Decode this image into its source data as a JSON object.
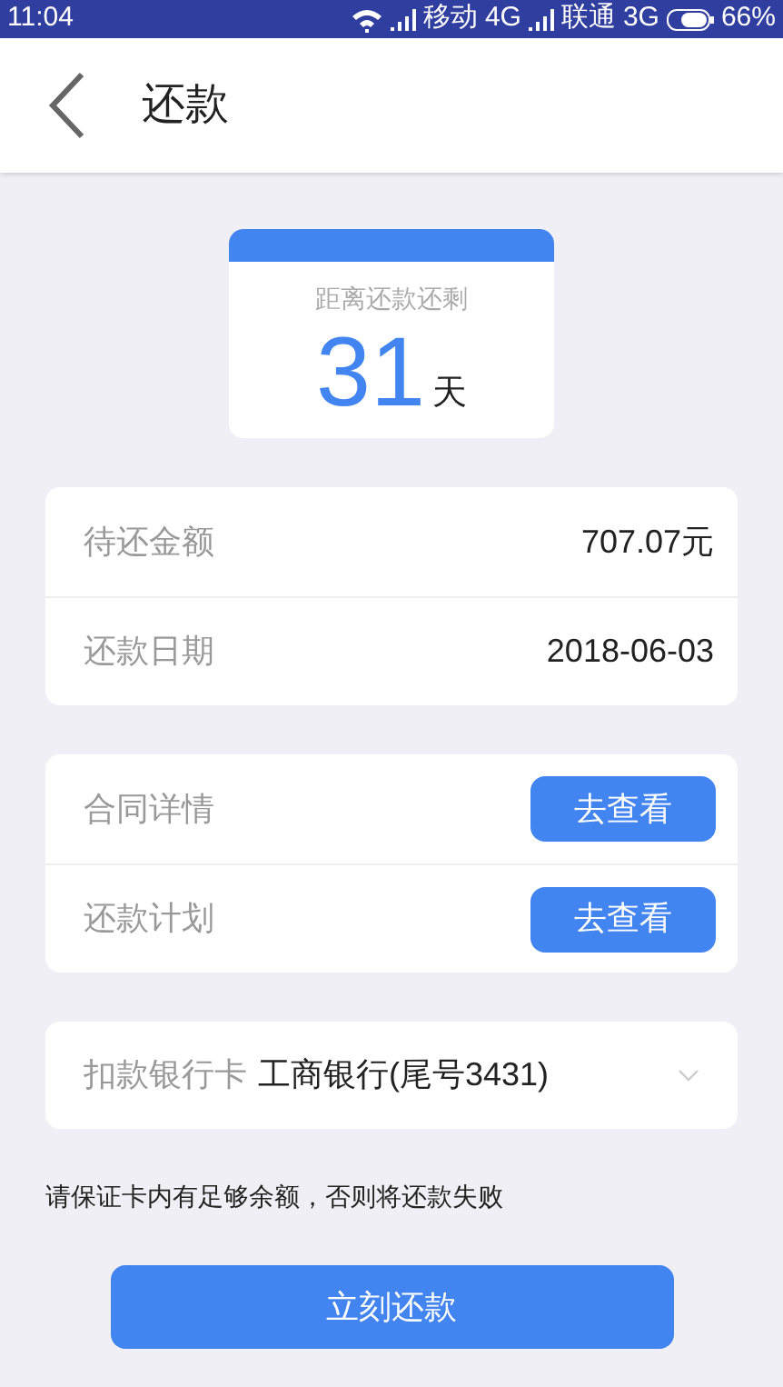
{
  "status_bar": {
    "time": "11:04",
    "carrier_1": "移动",
    "network_1": "4G",
    "carrier_2": "联通",
    "network_2": "3G",
    "battery": "66%"
  },
  "header": {
    "title": "还款"
  },
  "countdown": {
    "label": "距离还款还剩",
    "days": "31",
    "unit": "天"
  },
  "summary": [
    {
      "label": "待还金额",
      "value": "707.07元"
    },
    {
      "label": "还款日期",
      "value": "2018-06-03"
    }
  ],
  "links": [
    {
      "label": "合同详情",
      "button": "去查看"
    },
    {
      "label": "还款计划",
      "button": "去查看"
    }
  ],
  "bank_card": {
    "label": "扣款银行卡",
    "value": "工商银行(尾号3431)"
  },
  "notice": "请保证卡内有足够余额，否则将还款失败",
  "submit": "立刻还款"
}
